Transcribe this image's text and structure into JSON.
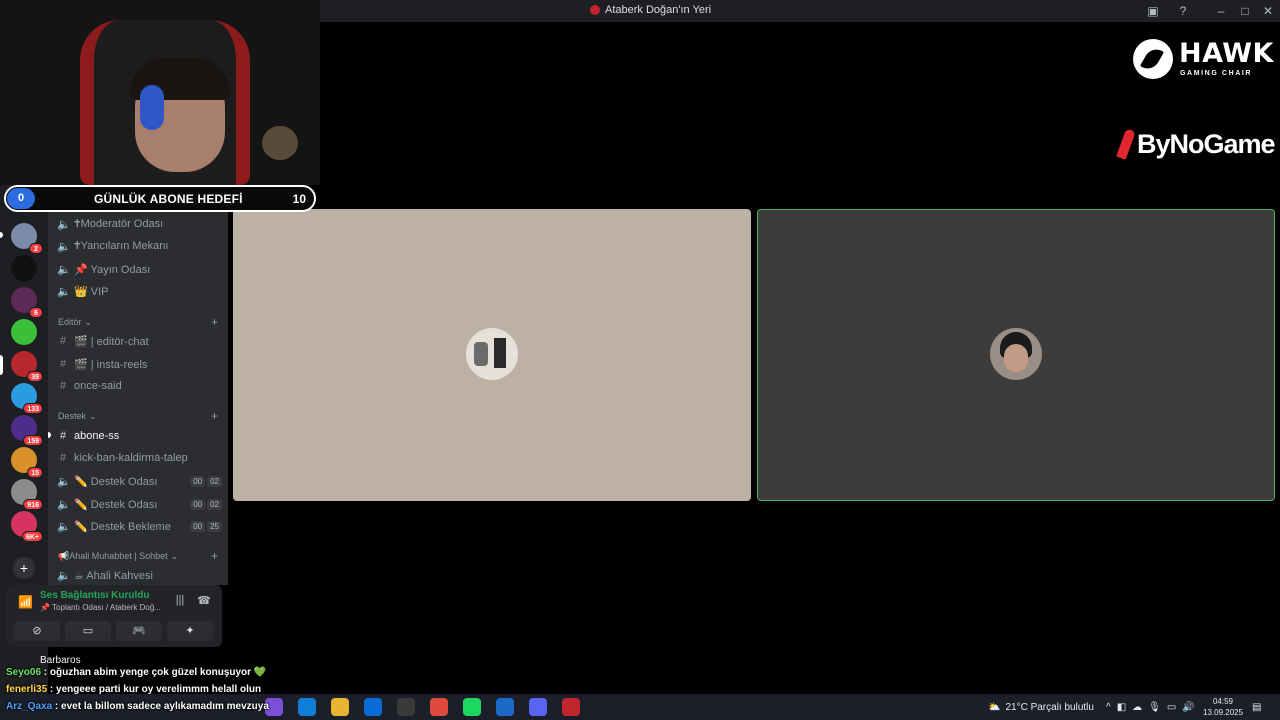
{
  "window": {
    "title": "Ataberk Doğan'ın Yeri"
  },
  "goal": {
    "current": "0",
    "label": "GÜNLÜK ABONE HEDEFİ",
    "target": "10"
  },
  "servers": [
    {
      "color": "#7a8aa8",
      "badge": "2"
    },
    {
      "color": "#111111",
      "badge": ""
    },
    {
      "color": "#5b2a55",
      "badge": "6"
    },
    {
      "color": "#3bbf3b",
      "badge": ""
    },
    {
      "color": "#b5282e",
      "badge": "39"
    },
    {
      "color": "#2b9be0",
      "badge": "133"
    },
    {
      "color": "#4e2c8a",
      "badge": "159"
    },
    {
      "color": "#d9922b",
      "badge": "15"
    },
    {
      "color": "#8c8c8c",
      "badge": "916"
    },
    {
      "color": "#d6345e",
      "badge": "6K+"
    }
  ],
  "channels": {
    "voice_top": [
      {
        "icon": "speaker-icon",
        "name": "🕇Moderatör Odası"
      },
      {
        "icon": "speaker-icon",
        "name": "🕇Yancıların Mekanı"
      },
      {
        "icon": "speaker-icon",
        "name": "📌 Yayın Odası"
      },
      {
        "icon": "speaker-icon",
        "name": "👑 VIP"
      }
    ],
    "editor_category": "Editör",
    "editor": [
      {
        "name": "🎬 | editör-chat"
      },
      {
        "name": "🎬 | insta-reels"
      },
      {
        "name": "once-said"
      }
    ],
    "support_category": "Destek",
    "support_text": [
      {
        "name": "abone-ss",
        "active": true
      },
      {
        "name": "kick-ban-kaldirma-talep",
        "active": false
      }
    ],
    "support_voice": [
      {
        "name": "✏️ Destek Odası",
        "t1": "00",
        "t2": "02"
      },
      {
        "name": "✏️ Destek Odası",
        "t1": "00",
        "t2": "02"
      },
      {
        "name": "✏️ Destek Bekleme",
        "t1": "00",
        "t2": "25"
      }
    ],
    "ahali_category": "📢Ahali Muhabbet | Sohbet",
    "ahali": [
      {
        "name": "☕ Ahali Kahvesi"
      }
    ]
  },
  "voice": {
    "status": "Ses Bağlantısı Kuruldu",
    "channel": "📌 Toplantı Odası / Ataberk Doğ..."
  },
  "user": {
    "name": "Barbaros"
  },
  "chat": [
    {
      "user": "Seyo06",
      "msg": " : oğuzhan abim yenge çok güzel konuşuyor ",
      "heart": "💚"
    },
    {
      "user": "fenerli35",
      "msg": " : yengeee parti kur oy verelimmm helall olun",
      "heart": ""
    },
    {
      "user": "Arz_Qaxa",
      "msg": " : evet la billom sadece aylıkamadım mevzuya",
      "heart": ""
    }
  ],
  "sponsors": {
    "hawk": "HAWK",
    "hawk_sub": "GAMING CHAIR",
    "bynogame": "ByNoGame"
  },
  "taskbar": {
    "weather": "21°C  Parçalı bulutlu",
    "time": "04:59",
    "date": "13.09.2025",
    "apps": [
      "#7b4fd6",
      "#0f7fd8",
      "#e8b431",
      "#0a6ad6",
      "#3a3a3a",
      "#e04a3c",
      "#1ed760",
      "#1b6ac9",
      "#5865f2",
      "#c0262c"
    ]
  }
}
